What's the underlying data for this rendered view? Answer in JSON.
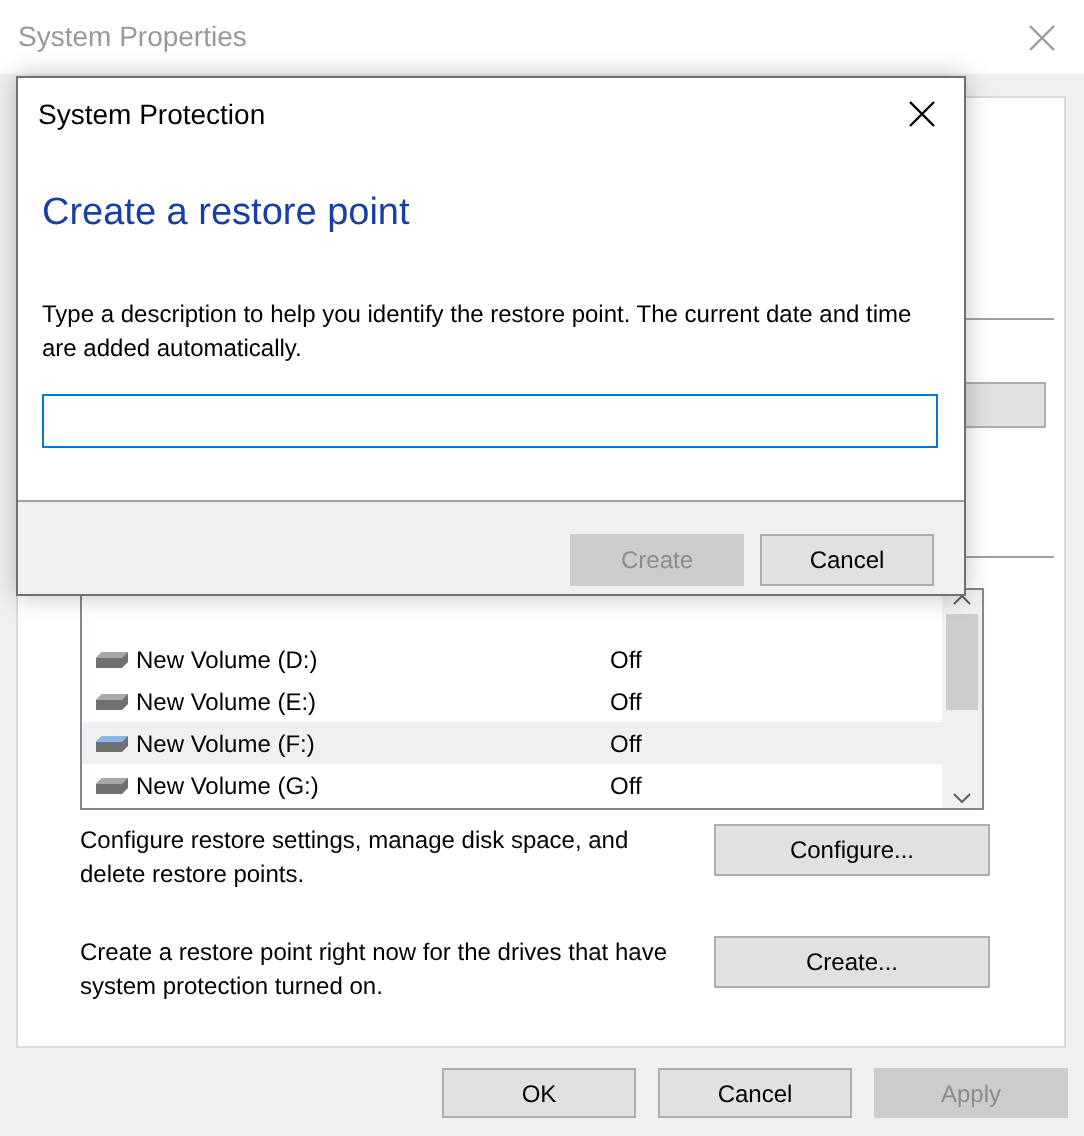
{
  "window": {
    "title": "System Properties"
  },
  "protection_list": {
    "rows": [
      {
        "name": "New Volume (D:)",
        "status": "Off",
        "color": "#a8a8a8",
        "selected": false
      },
      {
        "name": "New Volume (E:)",
        "status": "Off",
        "color": "#a8a8a8",
        "selected": false
      },
      {
        "name": "New Volume (F:)",
        "status": "Off",
        "color": "#8ab8e6",
        "selected": true
      },
      {
        "name": "New Volume (G:)",
        "status": "Off",
        "color": "#a8a8a8",
        "selected": false
      }
    ]
  },
  "actions": [
    {
      "text": "Configure restore settings, manage disk space, and delete restore points.",
      "button": "Configure..."
    },
    {
      "text": "Create a restore point right now for the drives that have system protection turned on.",
      "button": "Create..."
    }
  ],
  "footer_buttons": [
    {
      "label": "OK",
      "disabled": false
    },
    {
      "label": "Cancel",
      "disabled": false
    },
    {
      "label": "Apply",
      "disabled": true
    }
  ],
  "dialog": {
    "title": "System Protection",
    "heading": "Create a restore point",
    "description": "Type a description to help you identify the restore point. The current date and time are added automatically.",
    "buttons": [
      {
        "label": "Create",
        "disabled": true
      },
      {
        "label": "Cancel",
        "disabled": false
      }
    ]
  }
}
